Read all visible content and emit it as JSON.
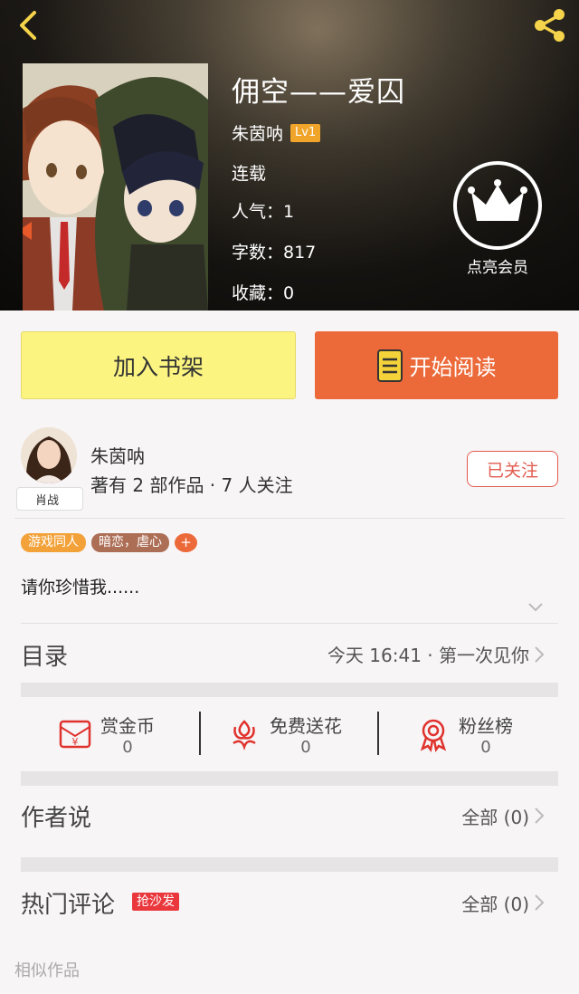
{
  "book": {
    "title": "佣空——爱囚",
    "author": "朱茵呐",
    "level": "Lv1",
    "status": "连载",
    "popularity": "人气：1",
    "word_count": "字数：817",
    "favorites": "收藏：0"
  },
  "vip": {
    "label": "点亮会员"
  },
  "actions": {
    "add_shelf": "加入书架",
    "start_reading": "开始阅读"
  },
  "author_card": {
    "name": "朱茵呐",
    "stats": "著有 2 部作品 · 7 人关注",
    "avatar_tag": "肖战",
    "follow": "已关注"
  },
  "tags": [
    "游戏同人",
    "暗恋，虐心"
  ],
  "tag_add": "+",
  "synopsis": "请你珍惜我......",
  "toc": {
    "label": "目录",
    "latest": "今天 16:41 · 第一次见你"
  },
  "stats": [
    {
      "label": "赏金币",
      "value": "0",
      "icon": "red-envelope-icon"
    },
    {
      "label": "免费送花",
      "value": "0",
      "icon": "flower-icon"
    },
    {
      "label": "粉丝榜",
      "value": "0",
      "icon": "medal-icon"
    }
  ],
  "author_says": {
    "label": "作者说",
    "all": "全部 (0)"
  },
  "hot_comments": {
    "label": "热门评论",
    "badge": "抢沙发",
    "all": "全部 (0)"
  },
  "similar": {
    "label": "相似作品"
  },
  "colors": {
    "accent": "#ec6a3a",
    "shelf_button": "#fbf481",
    "follow": "#e15b4f",
    "level_badge": "#f0a52a"
  }
}
